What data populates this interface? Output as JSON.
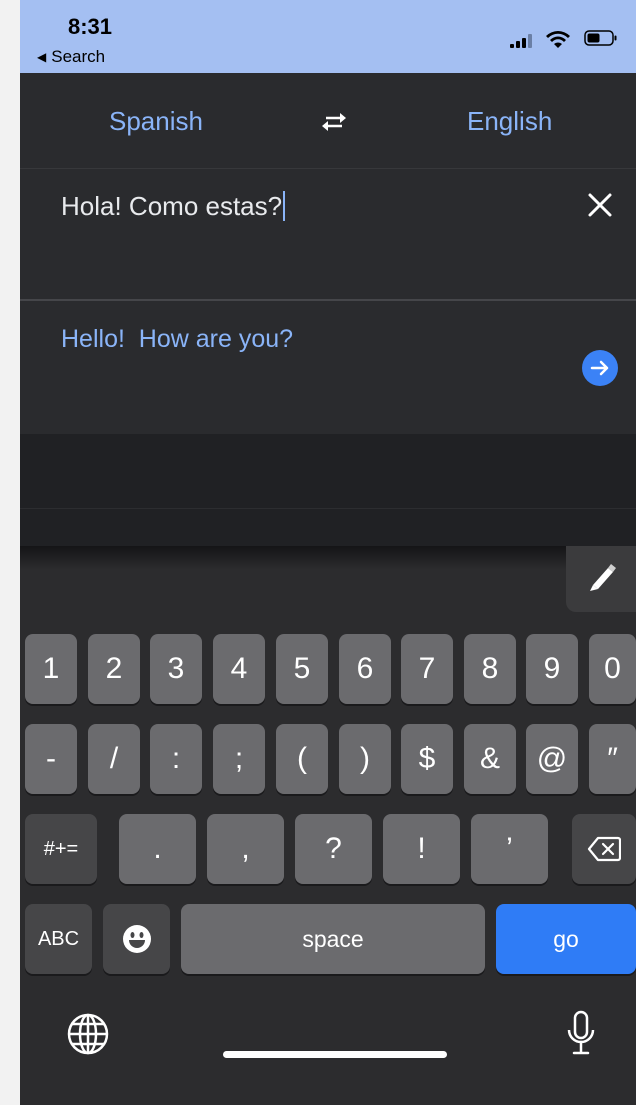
{
  "status_bar": {
    "time": "8:31",
    "back_label": "Search",
    "bg_color": "#a4bff2"
  },
  "language_bar": {
    "source_language": "Spanish",
    "target_language": "English",
    "swap_icon": "swap-arrows-icon"
  },
  "input": {
    "text": "Hola! Como estas?",
    "clear_icon": "close-icon"
  },
  "output": {
    "text": "Hello!  How are you?",
    "action_icon": "arrow-right-circle-icon"
  },
  "keyboard": {
    "row1": [
      "1",
      "2",
      "3",
      "4",
      "5",
      "6",
      "7",
      "8",
      "9",
      "0"
    ],
    "row2": [
      "-",
      "/",
      ":",
      ";",
      "(",
      ")",
      "$",
      "&",
      "@",
      "″"
    ],
    "row3": {
      "mode_key": "#+=",
      "keys": [
        ".",
        ",",
        "?",
        "!",
        "’"
      ],
      "delete_icon": "backspace-icon"
    },
    "row4": {
      "abc_key": "ABC",
      "emoji_icon": "emoji-icon",
      "space_label": "space",
      "go_label": "go"
    },
    "globe_icon": "globe-icon",
    "mic_icon": "microphone-icon",
    "handwriting_icon": "pencil-icon",
    "accent_color": "#2f7cf6"
  }
}
